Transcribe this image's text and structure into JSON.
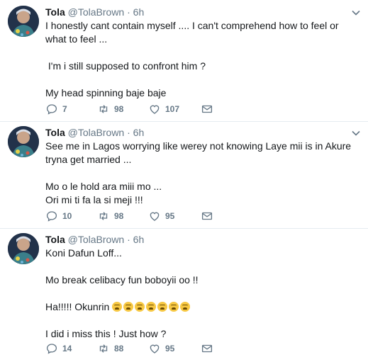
{
  "tweets": [
    {
      "name": "Tola",
      "handle": "@TolaBrown",
      "dot": "·",
      "time": "6h",
      "avatar_icon": "profile-photo",
      "paragraphs": [
        "I honestly cant contain myself .... I can't comprehend how to feel or what to feel ...",
        " I'm i still supposed to confront him ?",
        "My head spinning baje baje"
      ],
      "replies": "7",
      "retweets": "98",
      "likes": "107"
    },
    {
      "name": "Tola",
      "handle": "@TolaBrown",
      "dot": "·",
      "time": "6h",
      "avatar_icon": "profile-photo",
      "paragraphs": [
        "See me in Lagos worrying like werey not knowing Laye mii is in Akure tryna get married ...",
        "Mo o le hold ara miii mo ...\nOri mi ti fa la si meji !!!"
      ],
      "replies": "10",
      "retweets": "98",
      "likes": "95"
    },
    {
      "name": "Tola",
      "handle": "@TolaBrown",
      "dot": "·",
      "time": "6h",
      "avatar_icon": "profile-photo",
      "paragraphs": [
        "Koni Dafun Loff...",
        "Mo break celibacy fun boboyii oo !!",
        "Ha!!!!! Okunrin",
        "I did i miss this ! Just how ?"
      ],
      "emoji_count": 7,
      "emoji_icon": "weary-face-emoji",
      "replies": "14",
      "retweets": "88",
      "likes": "95"
    }
  ],
  "colors": {
    "text": "#14171a",
    "muted": "#657786",
    "divider": "#e6ecf0"
  }
}
